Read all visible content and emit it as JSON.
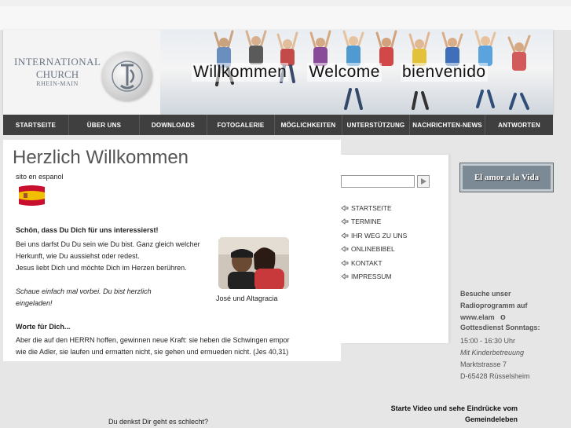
{
  "header": {
    "logo_line1": "INTERNATIONAL",
    "logo_line2": "CHURCH",
    "logo_line3": "RHEIN-MAIN",
    "banner_words": [
      "Willkommen",
      "Welcome",
      "bienvenido"
    ]
  },
  "nav": {
    "items": [
      "STARTSEITE",
      "ÜBER UNS",
      "DOWNLOADS",
      "FOTOGALERIE",
      "MÖGLICHKEITEN",
      "UNTERSTÜTZUNG",
      "NACHRICHTEN-NEWS",
      "ANTWORTEN"
    ]
  },
  "main": {
    "title": "Herzlich Willkommen",
    "sito": "sito en espanol",
    "section_title": "Schön, dass Du Dich für uns interessierst!",
    "para_lines": [
      "Bei uns darfst Du Du sein wie Du bist. Ganz gleich welcher",
      "Herkunft, wie Du aussiehst oder redest.",
      "Jesus liebt Dich und möchte Dich im Herzen berühren."
    ],
    "italic_lines": [
      "Schaue einfach mal vorbei. Du bist herzlich",
      "eingeladen!"
    ],
    "photo_caption": "José und Altagracia",
    "worte_title": "Worte für Dich...",
    "worte_lines": [
      "Aber die auf den HERRN hoffen, gewinnen neue Kraft: sie heben die Schwingen empor",
      "wie die Adler, sie laufen und ermatten nicht, sie gehen und ermueden nicht. (Jes 40,31)"
    ],
    "denkst": "Du denkst Dir geht es schlecht?"
  },
  "sidebar": {
    "links": [
      "STARTSEITE",
      "TERMINE",
      "IHR WEG ZU UNS",
      "ONLINEBIBEL",
      "KONTAKT",
      "IMPRESSUM"
    ]
  },
  "right": {
    "amor": "El amor a la Vida",
    "radio_lines": [
      "Besuche unser",
      "Radioprogramm auf",
      "www.elam"
    ],
    "radio_dot": "o",
    "gd_title": "Gottesdienst Sonntags:",
    "gd_time": "15:00 - 16:30 Uhr",
    "gd_kids": "Mit Kinderbetreuung",
    "gd_street": "Marktstrasse 7",
    "gd_city": "D-65428 Rüsselsheim",
    "video_line1": "Starte Video und sehe Eindrücke vom",
    "video_line2": "Gemeindeleben"
  },
  "colors": {
    "nav_bg": "#3f3f3f",
    "accent_gray": "#7c8a96"
  }
}
